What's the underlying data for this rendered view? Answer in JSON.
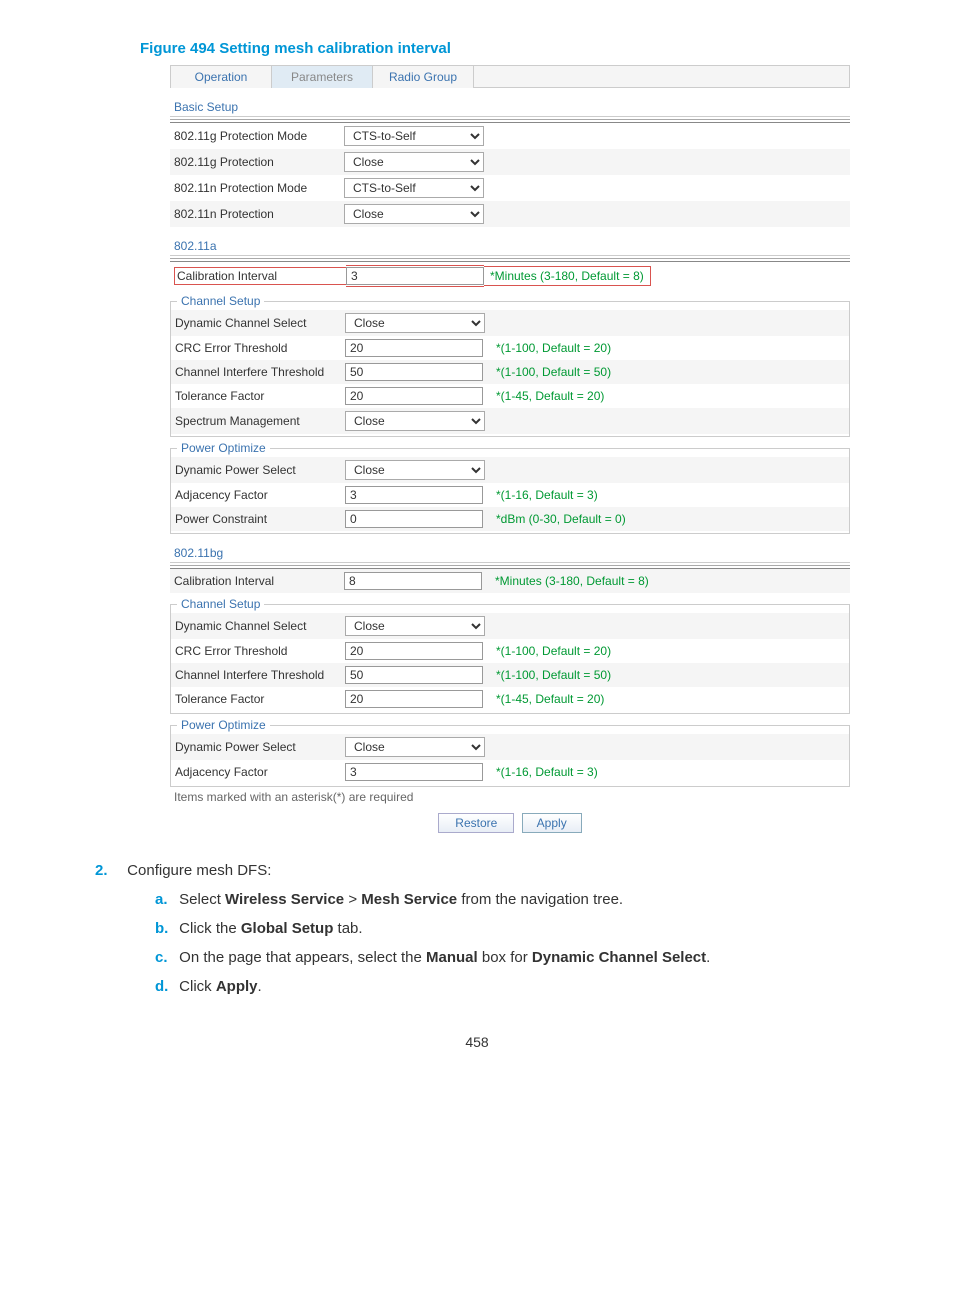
{
  "figure_title": "Figure 494 Setting mesh calibration interval",
  "tabs": {
    "operation": "Operation",
    "parameters": "Parameters",
    "radio_group": "Radio Group"
  },
  "basic": {
    "header": "Basic Setup",
    "r1_lbl": "802.11g Protection Mode",
    "r1_val": "CTS-to-Self",
    "r2_lbl": "802.11g Protection",
    "r2_val": "Close",
    "r3_lbl": "802.11n Protection Mode",
    "r3_val": "CTS-to-Self",
    "r4_lbl": "802.11n Protection",
    "r4_val": "Close"
  },
  "a": {
    "header": "802.11a",
    "cal_lbl": "Calibration Interval",
    "cal_val": "3",
    "cal_hint": "*Minutes (3-180, Default = 8)",
    "ch_legend": "Channel Setup",
    "dcs_lbl": "Dynamic Channel Select",
    "dcs_val": "Close",
    "crc_lbl": "CRC Error Threshold",
    "crc_val": "20",
    "crc_hint": "*(1-100, Default = 20)",
    "ci_lbl": "Channel Interfere Threshold",
    "ci_val": "50",
    "ci_hint": "*(1-100, Default = 50)",
    "tf_lbl": "Tolerance Factor",
    "tf_val": "20",
    "tf_hint": "*(1-45, Default = 20)",
    "sm_lbl": "Spectrum Management",
    "sm_val": "Close",
    "po_legend": "Power Optimize",
    "dps_lbl": "Dynamic Power Select",
    "dps_val": "Close",
    "af_lbl": "Adjacency Factor",
    "af_val": "3",
    "af_hint": "*(1-16, Default = 3)",
    "pc_lbl": "Power Constraint",
    "pc_val": "0",
    "pc_hint": "*dBm (0-30, Default = 0)"
  },
  "bg": {
    "header": "802.11bg",
    "cal_lbl": "Calibration Interval",
    "cal_val": "8",
    "cal_hint": "*Minutes (3-180, Default = 8)",
    "ch_legend": "Channel Setup",
    "dcs_lbl": "Dynamic Channel Select",
    "dcs_val": "Close",
    "crc_lbl": "CRC Error Threshold",
    "crc_val": "20",
    "crc_hint": "*(1-100, Default = 20)",
    "ci_lbl": "Channel Interfere Threshold",
    "ci_val": "50",
    "ci_hint": "*(1-100, Default = 50)",
    "tf_lbl": "Tolerance Factor",
    "tf_val": "20",
    "tf_hint": "*(1-45, Default = 20)",
    "po_legend": "Power Optimize",
    "dps_lbl": "Dynamic Power Select",
    "dps_val": "Close",
    "af_lbl": "Adjacency Factor",
    "af_val": "3",
    "af_hint": "*(1-16, Default = 3)"
  },
  "footer": {
    "marked": "Items marked with an asterisk(*) are required",
    "restore": "Restore",
    "apply": "Apply"
  },
  "instructions": {
    "step2_num": "2.",
    "step2_text": "Configure mesh DFS:",
    "a_m": "a.",
    "a_p1": "Select ",
    "a_b1": "Wireless Service",
    "a_p2": " > ",
    "a_b2": "Mesh Service",
    "a_p3": " from the navigation tree.",
    "b_m": "b.",
    "b_p1": "Click the ",
    "b_b1": "Global Setup",
    "b_p2": " tab.",
    "c_m": "c.",
    "c_p1": "On the page that appears, select the ",
    "c_b1": "Manual",
    "c_p2": " box for ",
    "c_b2": "Dynamic Channel Select",
    "c_p3": ".",
    "d_m": "d.",
    "d_p1": "Click ",
    "d_b1": "Apply",
    "d_p2": "."
  },
  "page_number": "458"
}
